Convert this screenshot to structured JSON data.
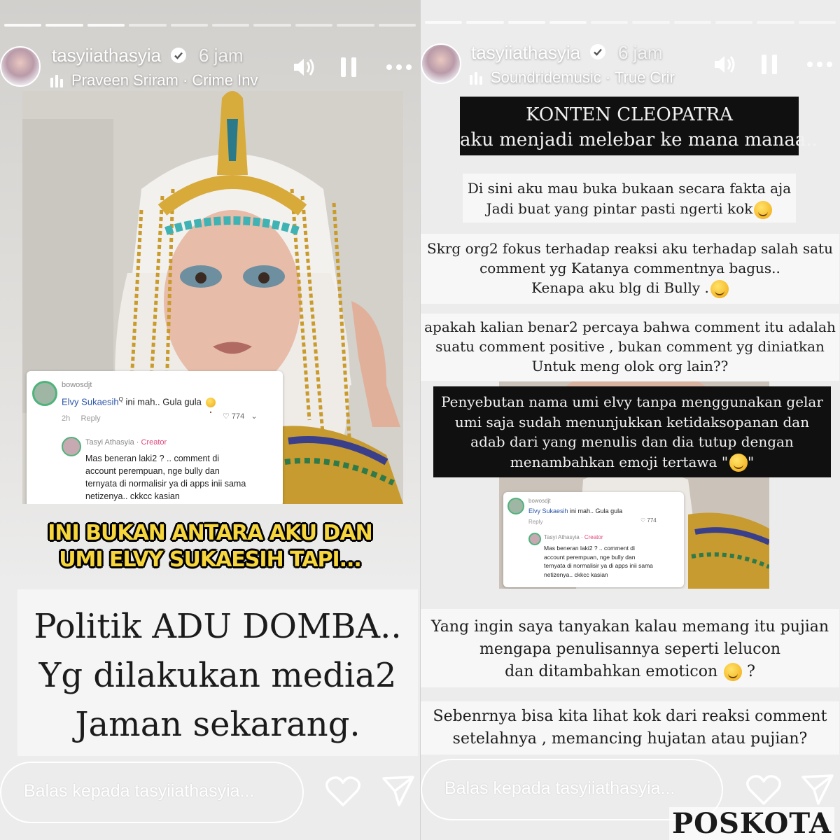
{
  "left": {
    "username": "tasyiiathasyia",
    "time": "6 jam",
    "music": "Praveen Sriram · Crime Inv",
    "comment": {
      "author": "bowosdjt",
      "mention": "Elvy Sukaesih",
      "text": "ini mah.. Gula gula",
      "time": "2h",
      "reply_label": "Reply",
      "likes": "774",
      "reply_author": "Tasyi Athasyia",
      "reply_role": "Creator",
      "reply_lines": [
        "Mas beneran laki2 ? .. comment di",
        "account perempuan, nge bully dan",
        "ternyata di normalisir ya di apps inii sama",
        "netizenya.. ckkcc kasian"
      ]
    },
    "caption_lines": [
      "INI BUKAN ANTARA AKU DAN",
      "UMI ELVY SUKAESIH TAPI..."
    ],
    "statement_lines": [
      "Politik ADU DOMBA..",
      "Yg dilakukan media2",
      "Jaman sekarang."
    ],
    "reply_placeholder": "Balas kepada tasyiiathasyia..."
  },
  "right": {
    "username": "tasyiiathasyia",
    "time": "6 jam",
    "music": "Soundridemusic · True Crir",
    "title_lines": [
      "KONTEN CLEOPATRA",
      "aku menjadi melebar ke mana manaa.."
    ],
    "para1": [
      "Di sini aku mau buka bukaan secara fakta aja",
      "Jadi buat yang pintar pasti ngerti kok"
    ],
    "para2": [
      "Skrg org2 fokus terhadap reaksi aku terhadap salah satu",
      "comment yg Katanya commentnya bagus..",
      "Kenapa aku blg di Bully ."
    ],
    "para3": [
      "apakah kalian benar2 percaya bahwa comment itu  adalah",
      "suatu comment positive , bukan comment yg diniatkan",
      "Untuk meng olok org lain??"
    ],
    "para4": [
      "Penyebutan nama umi elvy tanpa menggunakan gelar",
      "umi saja sudah menunjukkan ketidaksopanan dan",
      "adab dari yang menulis dan dia tutup dengan",
      "menambahkan emoji tertawa \""
    ],
    "para4_end": "\"",
    "comment": {
      "author": "bowosdjt",
      "mention": "Elvy Sukaesih",
      "text": "ini mah.. Gula gula",
      "reply_label": "Reply",
      "likes": "774",
      "reply_author": "Tasyi Athasyia",
      "reply_role": "Creator",
      "reply_lines": [
        "Mas beneran laki2 ? .. comment di",
        "account perempuan, nge bully dan",
        "ternyata di normalisir ya di apps inii sama",
        "netizenya.. ckkcc kasian"
      ]
    },
    "para5": [
      "Yang ingin saya tanyakan kalau memang itu pujian",
      "mengapa penulisannya seperti lelucon",
      "dan ditambahkan emoticon"
    ],
    "para5_end": " ?",
    "para6": [
      "Sebenrnya  bisa kita lihat kok dari reaksi comment",
      "setelahnya , memancing hujatan atau pujian?"
    ],
    "reply_placeholder": "Balas kepada tasyiiathasyia..."
  },
  "watermark": "POSKOTA",
  "icons": [
    "volume-icon",
    "pause-icon",
    "more-icon",
    "heart-icon",
    "send-icon",
    "verified-icon",
    "music-bars-icon"
  ]
}
